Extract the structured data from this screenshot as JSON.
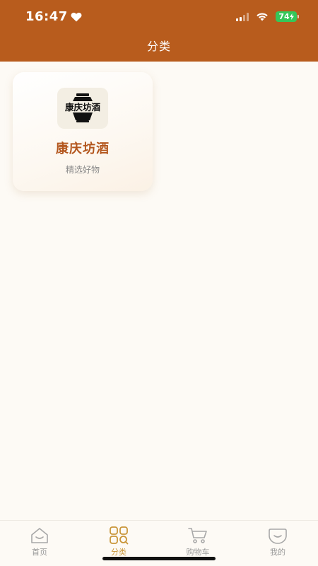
{
  "status_bar": {
    "time": "16:47",
    "battery": "74"
  },
  "header": {
    "title": "分类"
  },
  "categories": [
    {
      "logo_text": "康庆坊酒",
      "title": "康庆坊酒",
      "subtitle": "精选好物"
    }
  ],
  "tabbar": {
    "items": [
      {
        "label": "首页",
        "icon": "home-icon"
      },
      {
        "label": "分类",
        "icon": "category-icon",
        "active": true
      },
      {
        "label": "购物车",
        "icon": "cart-icon"
      },
      {
        "label": "我的",
        "icon": "profile-icon"
      }
    ]
  },
  "colors": {
    "header_bg": "#b85c1d",
    "accent": "#b3561d",
    "tab_active": "#c9963a",
    "page_bg": "#fdfaf5"
  }
}
